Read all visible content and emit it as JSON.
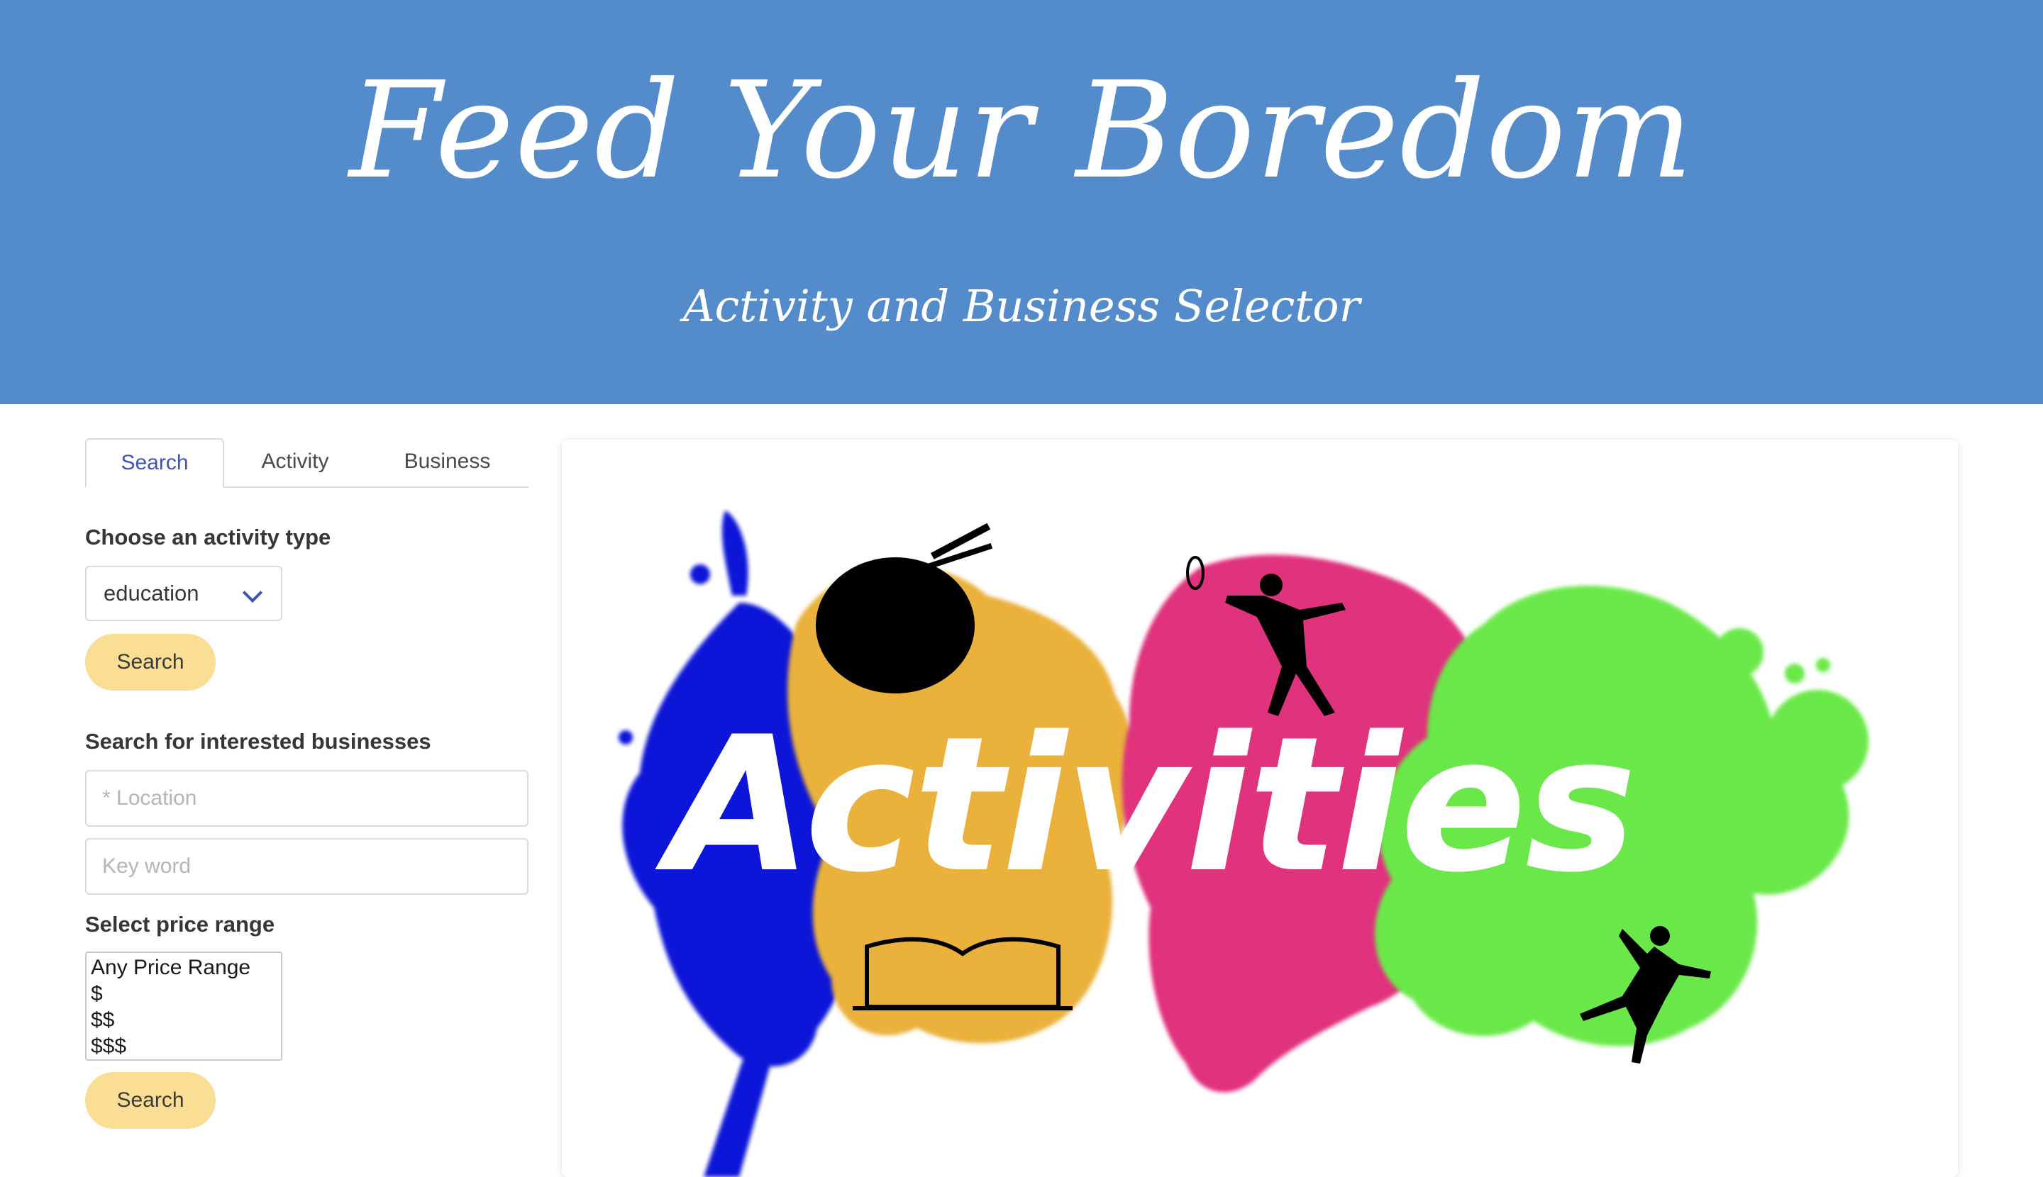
{
  "header": {
    "title": "Feed Your Boredom",
    "subtitle": "Activity and Business Selector"
  },
  "tabs": [
    {
      "label": "Search",
      "active": true
    },
    {
      "label": "Activity",
      "active": false
    },
    {
      "label": "Business",
      "active": false
    }
  ],
  "activity_search": {
    "label": "Choose an activity type",
    "selected_type": "education",
    "button_label": "Search"
  },
  "business_search": {
    "label": "Search for interested businesses",
    "location_placeholder": "* Location",
    "keyword_placeholder": "Key word",
    "price_label": "Select price range",
    "price_options": [
      "Any Price Range",
      "$",
      "$$",
      "$$$"
    ],
    "button_label": "Search"
  },
  "hero_image": {
    "text": "Activities",
    "colors": {
      "blue": "#0a14d8",
      "orange": "#eab13a",
      "pink": "#e0307d",
      "green": "#6ae84a"
    }
  },
  "colors": {
    "header_bg": "#538bcb",
    "accent": "#3e56b9",
    "button_bg": "#f9de93"
  }
}
